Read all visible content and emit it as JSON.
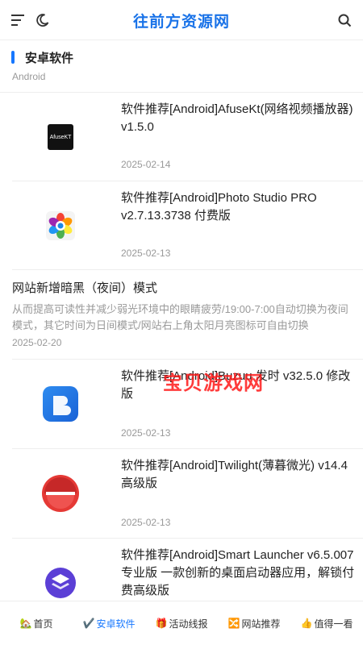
{
  "header": {
    "title": "往前方资源网",
    "menu_icon": "menu-icon",
    "theme_icon": "moon-icon",
    "search_icon": "search-icon",
    "accent": "#1a73e8"
  },
  "section": {
    "title": "安卓软件",
    "subtitle": "Android"
  },
  "items": [
    {
      "title": "软件推荐[Android]AfuseKt(网络视频播放器) v1.5.0",
      "date": "2025-02-14",
      "icon_label": "AfuseKT"
    },
    {
      "title": "软件推荐[Android]Photo Studio PRO v2.7.13.3738 付费版",
      "date": "2025-02-13"
    },
    {
      "title": "软件推荐[Android]Buzuu 发时 v32.5.0 修改版",
      "date": "2025-02-13"
    },
    {
      "title": "软件推荐[Android]Twilight(薄暮微光) v14.4 高级版",
      "date": "2025-02-13"
    },
    {
      "title": "软件推荐[Android]Smart Launcher v6.5.007 专业版 一款创新的桌面启动器应用，解锁付费高级版"
    }
  ],
  "post": {
    "title": "网站新增暗黑（夜间）模式",
    "excerpt": "从而提高可读性并减少弱光环境中的眼睛疲劳/19:00-7:00自动切换为夜间模式，其它时间为日间模式/网站右上角太阳月亮图标可自由切换",
    "date": "2025-02-20"
  },
  "watermark": "宝贝游戏网",
  "bottom_nav": [
    {
      "label": "首页",
      "icon": "🏡"
    },
    {
      "label": "安卓软件",
      "icon": "✔️"
    },
    {
      "label": "活动线报",
      "icon": "🎁"
    },
    {
      "label": "网站推荐",
      "icon": "🔀"
    },
    {
      "label": "值得一看",
      "icon": "👍"
    }
  ],
  "colors": {
    "accent": "#1677ff",
    "date": "#999999",
    "watermark": "#ff1a1a"
  }
}
